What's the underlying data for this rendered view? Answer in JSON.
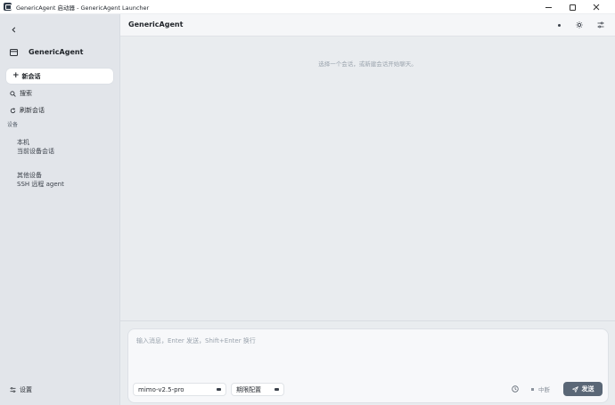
{
  "window": {
    "title": "GenericAgent 启动器 - GenericAgent Launcher"
  },
  "sidebar": {
    "brand": "GenericAgent",
    "new_chat": "新会话",
    "search": "搜索",
    "refresh": "刷新会话",
    "section_label": "设备",
    "devices": [
      {
        "name": "本机",
        "desc": "当前设备会话"
      },
      {
        "name": "其他设备",
        "desc": "SSH 远程 agent"
      }
    ],
    "settings": "设置"
  },
  "main": {
    "title": "GenericAgent",
    "empty_message": "选择一个会话，或新建会话开始聊天。"
  },
  "composer": {
    "placeholder": "输入消息，Enter 发送，Shift+Enter 换行",
    "model": "mimo-v2.5-pro",
    "config": "期限配置",
    "stop": "中断",
    "send": "发送"
  },
  "icons": {
    "app": "app-icon",
    "back": "chevron-left-icon",
    "brand": "window-icon",
    "search": "search-icon",
    "refresh": "refresh-icon",
    "settings": "settings-icon",
    "theme": "sun-icon",
    "filters": "sliders-icon",
    "history": "clock-icon",
    "send": "paper-plane-icon"
  }
}
